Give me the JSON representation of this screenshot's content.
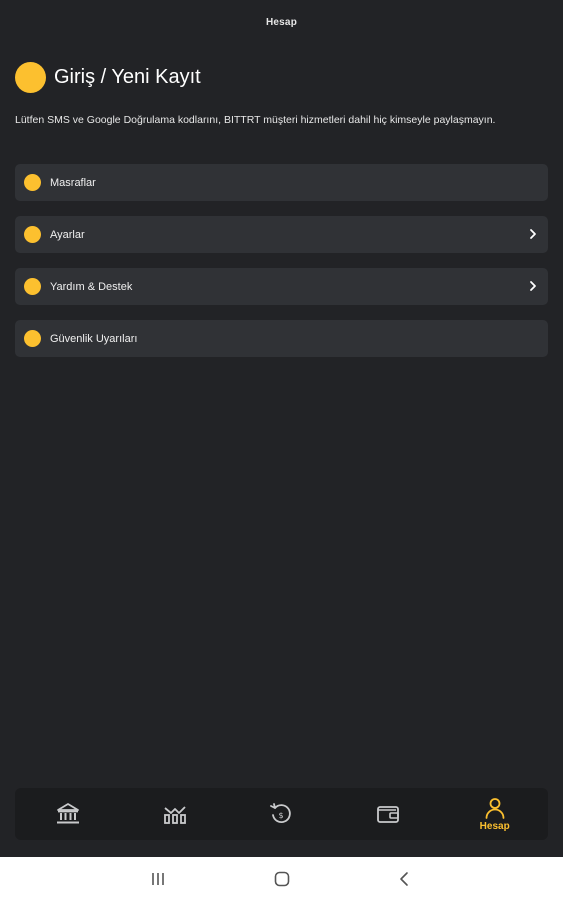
{
  "header": {
    "title": "Hesap"
  },
  "login": {
    "label": "Giriş / Yeni Kayıt"
  },
  "notice": "Lütfen SMS ve Google Doğrulama kodlarını, BITTRT müşteri hizmetleri dahil hiç kimseyle paylaşmayın.",
  "menu": {
    "items": [
      {
        "label": "Masraflar",
        "has_chevron": false
      },
      {
        "label": "Ayarlar",
        "has_chevron": true
      },
      {
        "label": "Yardım & Destek",
        "has_chevron": true
      },
      {
        "label": "Güvenlik Uyarıları",
        "has_chevron": false
      }
    ]
  },
  "bottom_nav": {
    "items": [
      {
        "icon": "bank-icon",
        "label": ""
      },
      {
        "icon": "markets-icon",
        "label": ""
      },
      {
        "icon": "history-icon",
        "label": ""
      },
      {
        "icon": "wallet-icon",
        "label": ""
      },
      {
        "icon": "person-icon",
        "label": "Hesap",
        "active": true
      }
    ]
  },
  "colors": {
    "background": "#222326",
    "card": "#303236",
    "accent": "#fcc02f",
    "nav_background": "#1b1c1e"
  },
  "system_nav": {
    "icons": [
      "recent-apps-icon",
      "home-icon",
      "back-icon"
    ]
  }
}
